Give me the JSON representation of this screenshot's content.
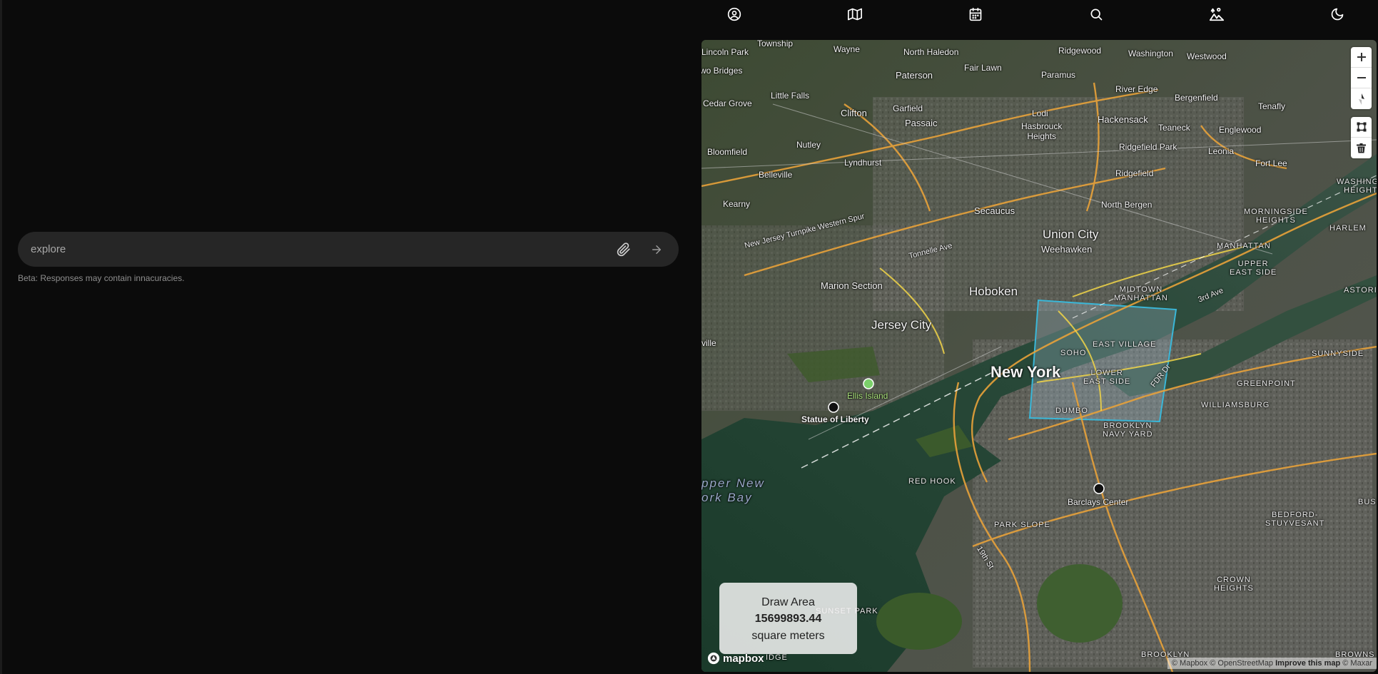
{
  "chat": {
    "placeholder": "explore",
    "beta_note": "Beta: Responses may contain innacuracies.",
    "attach_icon": "paperclip-icon",
    "send_icon": "arrow-right-icon"
  },
  "topbar": {
    "icons": [
      "user-circle-icon",
      "map-icon",
      "calendar-icon",
      "search-icon",
      "terrain-person-icon",
      "moon-icon"
    ]
  },
  "map": {
    "labels": {
      "township": "Township",
      "wayne": "Wayne",
      "north_haledon": "North Haledon",
      "ridgewood": "Ridgewood",
      "washington": "Washington",
      "westwood": "Westwood",
      "lincoln_park": "Lincoln Park",
      "fair_lawn": "Fair Lawn",
      "paramus": "Paramus",
      "two_bridges": "wo Bridges",
      "paterson": "Paterson",
      "river_edge": "River Edge",
      "bergenfield": "Bergenfield",
      "little_falls": "Little Falls",
      "cedar_grove": "Cedar Grove",
      "garfield": "Garfield",
      "lodi": "Lodi",
      "tenafly": "Tenafly",
      "clifton": "Clifton",
      "hackensack": "Hackensack",
      "teaneck": "Teaneck",
      "englewood": "Englewood",
      "passaic": "Passaic",
      "hasbrouck_heights": "Hasbrouck\nHeights",
      "nutley": "Nutley",
      "ridgefield_park": "Ridgefield Park",
      "leonia": "Leonia",
      "bloomfield": "Bloomfield",
      "fort_lee": "Fort Lee",
      "lyndhurst": "Lyndhurst",
      "ridgefield": "Ridgefield",
      "belleville": "Belleville",
      "washington_heights": "WASHINGTO\nHEIGHTS",
      "kearny": "Kearny",
      "secaucus": "Secaucus",
      "north_bergen": "North Bergen",
      "morningside_heights": "MORNINGSIDE\nHEIGHTS",
      "harlem": "HARLEM",
      "nj_turnpike": "New Jersey Turnpike Western Spur",
      "union_city": "Union City",
      "weehawken": "Weehawken",
      "manhattan": "MANHATTAN",
      "upper_east_side": "UPPER\nEAST SIDE",
      "tonnelle_ave": "Tonnelle Ave",
      "marion_section": "Marion Section",
      "hoboken": "Hoboken",
      "midtown_manhattan": "MIDTOWN\nMANHATTAN",
      "third_ave": "3rd Ave",
      "astoria": "ASTORIA",
      "jersey_city": "Jersey City",
      "east_village": "EAST VILLAGE",
      "soho": "SOHO",
      "sunnyside": "SUNNYSIDE",
      "new_york": "New York",
      "lower_east_side": "LOWER\nEAST SIDE",
      "fdr_dr": "FDR Dr",
      "greenpoint": "GREENPOINT",
      "ellis_island": "Ellis Island",
      "williamsburg": "WILLIAMSBURG",
      "dumbo": "DUMBO",
      "statue_of_liberty": "Statue of Liberty",
      "brooklyn_navy_yard": "BROOKLYN\nNAVY YARD",
      "upper_new_york_bay": "pper New\nork Bay",
      "red_hook": "RED HOOK",
      "barclays_center": "Barclays Center",
      "bedford_stuyvesant": "BEDFORD-\nSTUYVESANT",
      "bushwick": "BUS",
      "park_slope": "PARK SLOPE",
      "ninth_st": "19th St",
      "crown_heights": "CROWN\nHEIGHTS",
      "sunset_park": "SUNSET PARK",
      "brooklyn": "BROOKLYN",
      "brownsville": "BROWNS",
      "ridge": "IDGE",
      "ville": "ville"
    },
    "draw_area": {
      "title": "Draw Area",
      "value": "15699893.44",
      "unit": "square meters"
    },
    "attribution": {
      "mapbox": "© Mapbox",
      "osm": "© OpenStreetMap",
      "improve": "Improve this map",
      "maxar": "© Maxar"
    },
    "logo": "mapbox",
    "controls": [
      "zoom-in-icon",
      "zoom-out-icon",
      "compass-icon",
      "draw-polygon-icon",
      "trash-icon"
    ]
  }
}
